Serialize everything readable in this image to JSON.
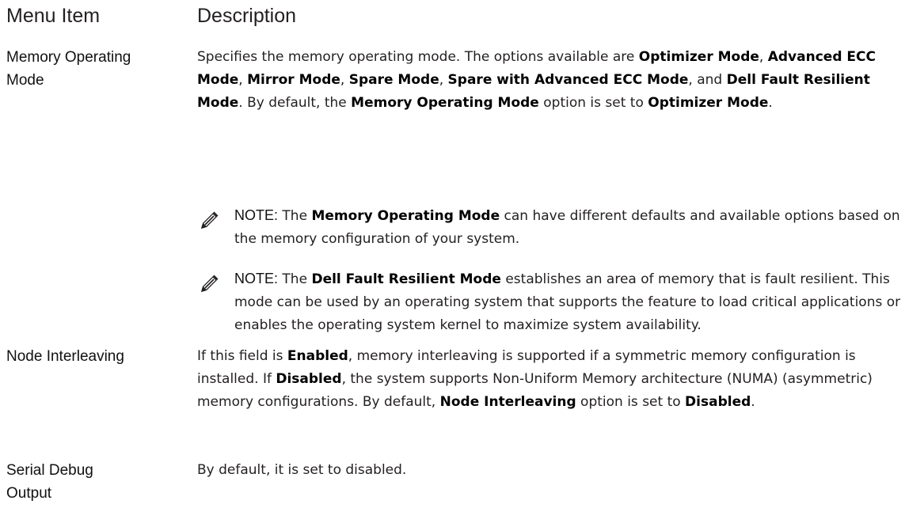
{
  "table": {
    "headers": {
      "menu_item": "Menu Item",
      "description": "Description"
    }
  },
  "memory_operating_mode": {
    "item_line1": "Memory Operating",
    "item_line2": "Mode",
    "desc": {
      "t1": "Specifies the memory operating mode. The options available are ",
      "b1": "Optimizer Mode",
      "t2": ", ",
      "b2": "Advanced ECC Mode",
      "t3": ", ",
      "b3": "Mirror Mode",
      "t4": ", ",
      "b4": "Spare Mode",
      "t5": ", ",
      "b5": "Spare with Advanced ECC Mode",
      "t6": ", and ",
      "b6": "Dell Fault Resilient Mode",
      "t7": ". By default, the ",
      "b7": "Memory Operating Mode",
      "t8": " option is set to ",
      "b8": "Optimizer Mode",
      "t9": "."
    },
    "note1": {
      "label": "NOTE:",
      "t1": " The ",
      "b1": "Memory Operating Mode",
      "t2": " can have different defaults and available options based on the memory configuration of your system."
    },
    "note2": {
      "label": "NOTE:",
      "t1": " The ",
      "b1": "Dell Fault Resilient Mode",
      "t2": " establishes an area of memory that is fault resilient. This mode can be used by an operating system that supports the feature to load critical applications or enables the operating system kernel to maximize system availability."
    }
  },
  "node_interleaving": {
    "item": "Node Interleaving",
    "desc": {
      "t1": "If this field is ",
      "b1": "Enabled",
      "t2": ", memory interleaving is supported if a symmetric memory configuration is installed. If ",
      "b2": "Disabled",
      "t3": ", the system supports Non-Uniform Memory architecture (NUMA) (asymmetric) memory configurations. By default, ",
      "b3": "Node Interleaving",
      "t4": " option is set to ",
      "b4": "Disabled",
      "t5": "."
    }
  },
  "serial_debug_output": {
    "item_line1": "Serial Debug",
    "item_line2": "Output",
    "desc": "By default, it is set to disabled."
  },
  "icons": {
    "note": "pencil-note-icon",
    "color": "#231f20"
  }
}
